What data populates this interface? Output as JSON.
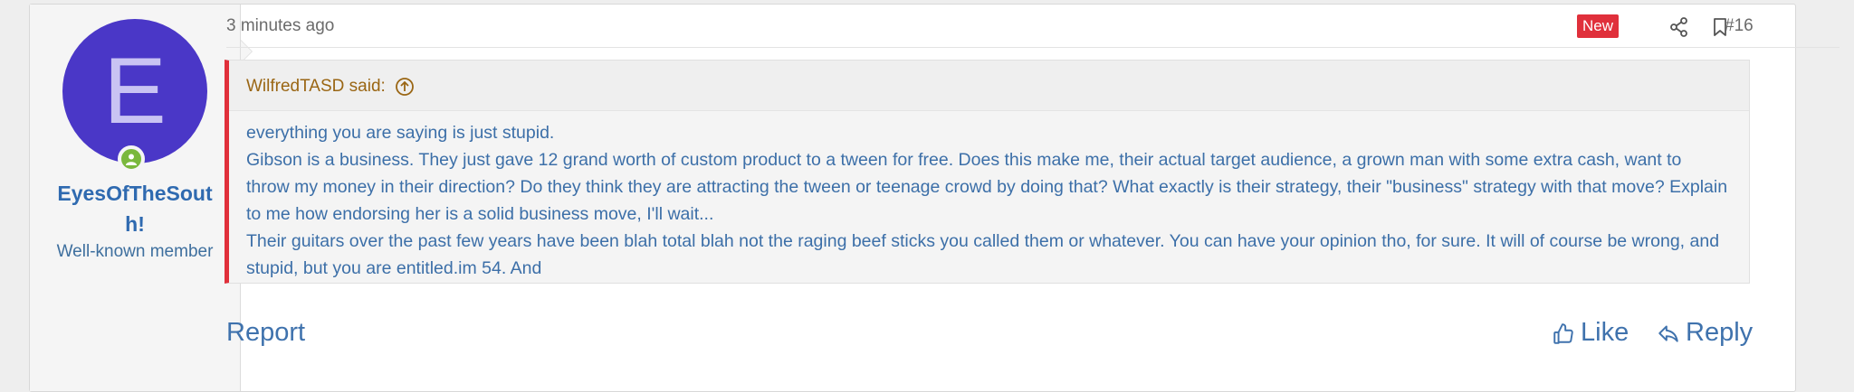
{
  "user": {
    "avatar_letter": "E",
    "avatar_color": "#4a37c7",
    "username": "EyesOfTheSouth!",
    "title": "Well-known member",
    "online_icon": "user-online-icon"
  },
  "post": {
    "time": "3 minutes ago",
    "badge": "New",
    "number": "#16",
    "icons": [
      "share-icon",
      "bookmark-icon"
    ]
  },
  "quote": {
    "author": "WilfredTASD said:",
    "lines": [
      "everything you are saying is just stupid.",
      "Gibson is a business. They just gave 12 grand worth of custom product to a tween for free. Does this make me, their actual target audience, a grown man with some extra cash, want to throw my money in their direction? Do they think they are attracting the tween or teenage crowd by doing that? What exactly is their strategy, their \"business\" strategy with that move? Explain to me how endorsing her is a solid business move, I'll wait...",
      "Their guitars over the past few years have been blah total blah not the raging beef sticks you called them or whatever. You can have your opinion tho, for sure. It will of course be wrong, and stupid, but you are entitled.im 54. And"
    ]
  },
  "actions": {
    "report": "Report",
    "like": "Like",
    "reply": "Reply"
  },
  "colors": {
    "accent_red": "#e0303b",
    "link_blue": "#3f72ad",
    "quote_author": "#9a6614"
  }
}
